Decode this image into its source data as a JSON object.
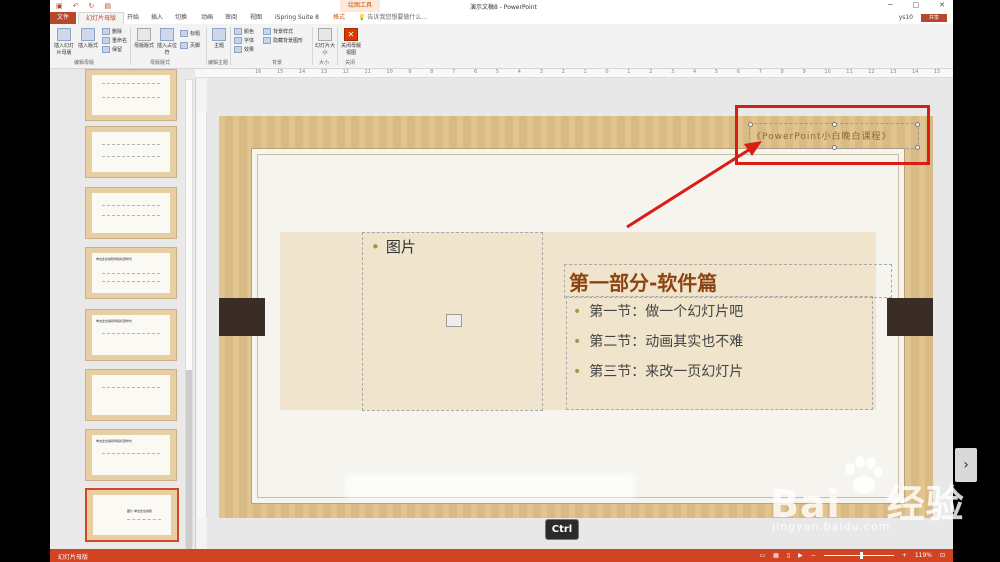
{
  "window": {
    "context_tool_title": "绘图工具",
    "document_title": "演示文稿8 - PowerPoint",
    "controls": [
      "─",
      "□",
      "✕"
    ]
  },
  "tabs": {
    "file": "文件",
    "items": [
      "幻灯片母版",
      "开始",
      "插入",
      "切换",
      "动画",
      "审阅",
      "视图",
      "iSpring Suite 8",
      "格式"
    ],
    "active_index": 0,
    "tell_me": "告诉我您想要做什么...",
    "user": "ys10",
    "share": "共享"
  },
  "ribbon": {
    "insert_slide_master": "插入幻灯片母版",
    "insert_layout": "插入版式",
    "delete": "删除",
    "rename": "重命名",
    "preserve": "保留",
    "group_edit_master": "编辑母版",
    "master_layout": "母版版式",
    "insert_placeholder": "插入占位符",
    "title_cb": "标题",
    "footer_cb": "页脚",
    "group_master_layout": "母版版式",
    "themes": "主题",
    "group_edit_theme": "编辑主题",
    "colors": "颜色",
    "fonts": "字体",
    "effects": "效果",
    "bg_styles": "背景样式",
    "hide_bg": "隐藏背景图形",
    "group_background": "背景",
    "slide_size": "幻灯片大小",
    "group_size": "大小",
    "close_master": "关闭母版视图",
    "group_close": "关闭"
  },
  "ruler_marks": [
    "16",
    "15",
    "14",
    "13",
    "12",
    "11",
    "10",
    "9",
    "8",
    "7",
    "6",
    "5",
    "4",
    "3",
    "2",
    "1",
    "0",
    "1",
    "2",
    "3",
    "4",
    "5",
    "6",
    "7",
    "8",
    "9",
    "10",
    "11",
    "12",
    "13",
    "14",
    "15",
    "16"
  ],
  "thumbnails": [
    {
      "title": ""
    },
    {
      "title": ""
    },
    {
      "title": ""
    },
    {
      "title": "单击此处编辑母版标题样式"
    },
    {
      "title": "单击此处编辑母版标题样式"
    },
    {
      "title": ""
    },
    {
      "title": "单击此处编辑母版标题样式"
    },
    {
      "title": "图片 单击此处编辑"
    }
  ],
  "slide": {
    "tag_text": "《PowerPoint小白晚白课程》",
    "picture_placeholder_label": "图片",
    "heading": "第一部分-软件篇",
    "list": [
      "第一节：做一个幻灯片吧",
      "第二节：动画其实也不难",
      "第三节：来改一页幻灯片"
    ]
  },
  "overlay": {
    "key_hint": "Ctrl"
  },
  "status": {
    "view_label": "幻灯片母版",
    "zoom": "119%"
  },
  "watermark": {
    "brand_left": "Bai",
    "brand_right": "经验",
    "url": "jingyan.baidu.com"
  },
  "colors": {
    "accent": "#b7472a",
    "status_bar": "#d04423",
    "highlight_red": "#d91e18",
    "heading_brown": "#8b4513",
    "bullet_green": "#8aa34b"
  }
}
